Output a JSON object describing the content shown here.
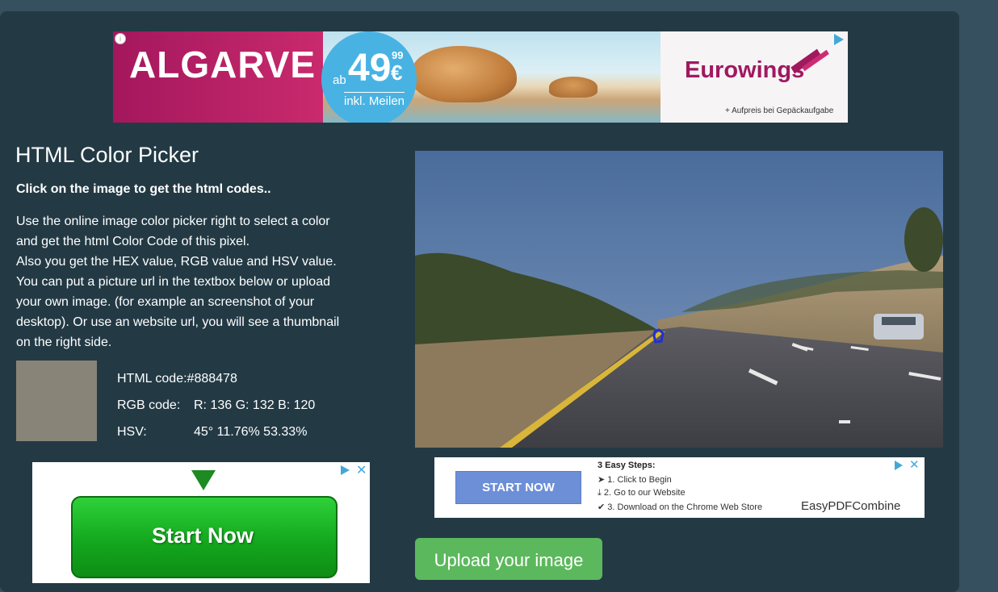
{
  "banner_ad": {
    "headline": "ALGARVE",
    "price_prefix": "ab",
    "price_main": "49",
    "price_cents": "99",
    "price_currency": "€",
    "price_note": "inkl. Meilen",
    "brand": "Eurowings",
    "fine_print": "+ Aufpreis bei Gepäckaufgabe",
    "info_icon": "i"
  },
  "page": {
    "title": "HTML Color Picker",
    "instruction": "Click on the image to get the html codes..",
    "description_lines": [
      "Use the online image color picker right to select a color",
      "and get the html Color Code of this pixel.",
      "Also you get the HEX value, RGB value and HSV value.",
      "You can put a picture url in the textbox below or upload",
      "your own image. (for example an screenshot of your",
      "desktop). Or use an website url, you will see a thumbnail",
      "on the right side."
    ]
  },
  "color_result": {
    "swatch_color": "#888478",
    "html_code_label": "HTML code:",
    "html_code_value": "#888478",
    "rgb_label": "RGB code:",
    "rgb_value": "R: 136 G: 132 B: 120",
    "hsv_label": "HSV:",
    "hsv_value": "45° 11.76% 53.33%"
  },
  "small_ad": {
    "button_label": "START NOW",
    "steps_title": "3 Easy Steps:",
    "steps": [
      "1. Click to Begin",
      "2. Go to our Website",
      "3. Download on the Chrome Web Store"
    ],
    "brand": "EasyPDFCombine",
    "close": "✕"
  },
  "big_ad": {
    "button_label": "Start Now",
    "close": "✕"
  },
  "upload_button": "Upload your image",
  "icons": [
    "info-icon",
    "adchoices-icon",
    "close-icon",
    "down-arrow-icon",
    "cursor-icon",
    "download-icon",
    "check-icon",
    "picker-marker-icon"
  ],
  "colors": {
    "background": "#36505f",
    "panel": "#233a45",
    "upload_button": "#5cb85c",
    "picker_marker": "#1f2fd8"
  }
}
